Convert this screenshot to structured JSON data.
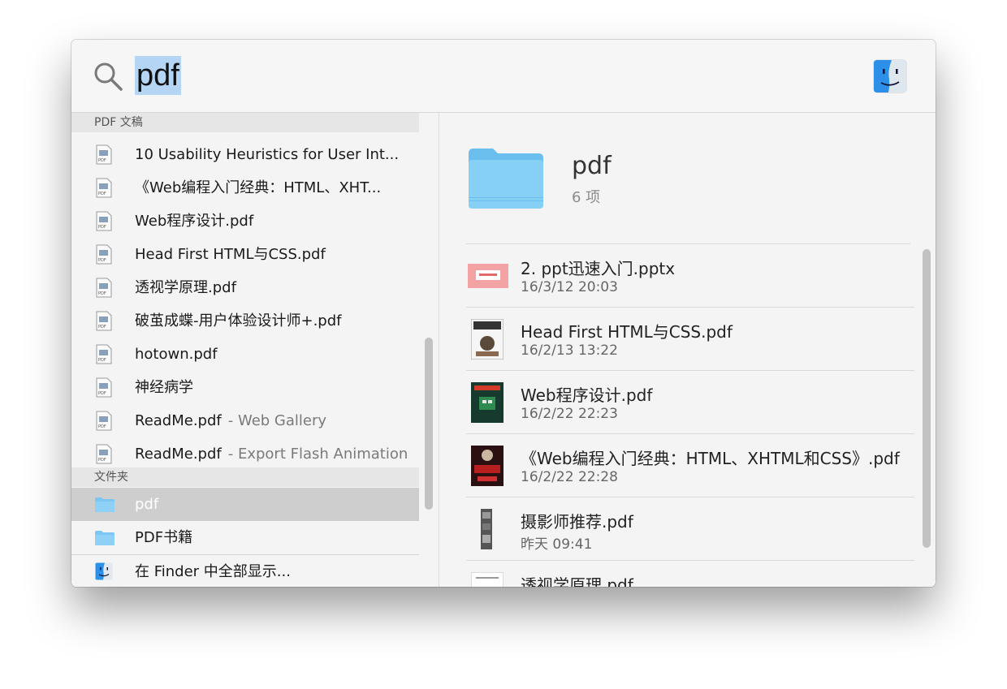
{
  "search": {
    "query": "pdf"
  },
  "left": {
    "sections": [
      {
        "header": "PDF 文稿"
      },
      {
        "header": "文件夹"
      }
    ],
    "pdf_items": [
      {
        "label": "10 Usability Heuristics for User Int...",
        "sub": ""
      },
      {
        "label": "《Web编程入门经典：HTML、XHT...",
        "sub": ""
      },
      {
        "label": "Web程序设计.pdf",
        "sub": ""
      },
      {
        "label": "Head First HTML与CSS.pdf",
        "sub": ""
      },
      {
        "label": "透视学原理.pdf",
        "sub": ""
      },
      {
        "label": "破茧成蝶-用户体验设计师+.pdf",
        "sub": ""
      },
      {
        "label": "hotown.pdf",
        "sub": ""
      },
      {
        "label": "神经病学",
        "sub": ""
      },
      {
        "label": "ReadMe.pdf",
        "sub": "- Web Gallery"
      },
      {
        "label": "ReadMe.pdf",
        "sub": "- Export Flash Animation"
      }
    ],
    "folder_items": [
      {
        "label": "pdf",
        "selected": true
      },
      {
        "label": "PDF书籍",
        "selected": false
      }
    ],
    "finder_footer": "在 Finder 中全部显示..."
  },
  "preview": {
    "title": "pdf",
    "count": "6 项",
    "files": [
      {
        "name": "2. ppt迅速入门.pptx",
        "date": "16/3/12 20:03"
      },
      {
        "name": "Head First HTML与CSS.pdf",
        "date": "16/2/13 13:22"
      },
      {
        "name": "Web程序设计.pdf",
        "date": "16/2/22 22:23"
      },
      {
        "name": "《Web编程入门经典：HTML、XHTML和CSS》.pdf",
        "date": "16/2/22 22:28"
      },
      {
        "name": "摄影师推荐.pdf",
        "date": "昨天 09:41"
      },
      {
        "name": "透视学原理.pdf",
        "date": ""
      }
    ]
  },
  "colors": {
    "selection": "#b5d5f5",
    "folder_blue": "#7cc6f4",
    "row_selected": "#cecece"
  }
}
